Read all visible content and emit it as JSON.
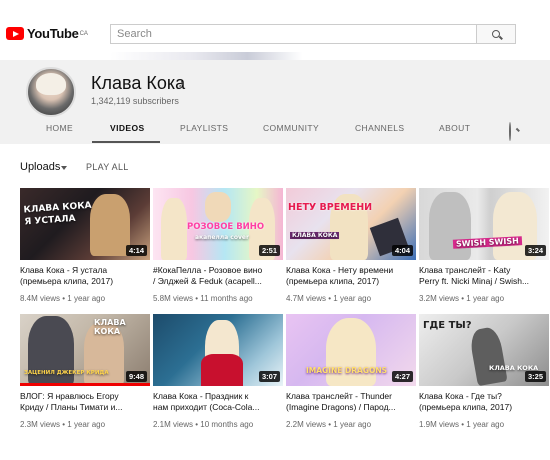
{
  "masthead": {
    "logo_text": "YouTube",
    "logo_region": "CA",
    "search_placeholder": "Search"
  },
  "channel": {
    "name": "Клава Кока",
    "subscribers": "1,342,119 subscribers"
  },
  "tabs": [
    {
      "label": "HOME"
    },
    {
      "label": "VIDEOS"
    },
    {
      "label": "PLAYLISTS"
    },
    {
      "label": "COMMUNITY"
    },
    {
      "label": "CHANNELS"
    },
    {
      "label": "ABOUT"
    }
  ],
  "uploads": {
    "label": "Uploads",
    "play_all": "PLAY ALL"
  },
  "videos": [
    {
      "title_line1": "Клава Кока - Я устала",
      "title_line2": "(премьера клипа, 2017)",
      "views": "8.4M views",
      "age": "1 year ago",
      "duration": "4:14",
      "thumb_text": "КЛАВА КОКА Я УСТАЛА"
    },
    {
      "title_line1": "#КокаПелла - Розовое вино",
      "title_line2": "/ Элджей & Feduk (acapell...",
      "views": "5.8M views",
      "age": "11 months ago",
      "duration": "2:51",
      "thumb_text": "РОЗОВОЕ ВИНО",
      "thumb_sub": "акапелла cover"
    },
    {
      "title_line1": "Клава Кока - Нету времени",
      "title_line2": "(премьера клипа, 2017)",
      "views": "4.7M views",
      "age": "1 year ago",
      "duration": "4:04",
      "thumb_text": "НЕТУ ВРЕМЕНИ",
      "thumb_sub": "КЛАВА КОКА"
    },
    {
      "title_line1": "Клава транслейт - Katy",
      "title_line2": "Perry ft. Nicki Minaj / Swish...",
      "views": "3.2M views",
      "age": "1 year ago",
      "duration": "3:24",
      "thumb_text": "SWISH SWISH"
    },
    {
      "title_line1": "ВЛОГ: Я нравлюсь Егору",
      "title_line2": "Криду / Планы Тимати и...",
      "views": "2.3M views",
      "age": "1 year ago",
      "duration": "9:48",
      "thumb_text": "КЛАВА КОКА",
      "thumb_sub": "ЗАЦЕНИЛ ДЖЕКЕР КРИДА"
    },
    {
      "title_line1": "Клава Кока - Праздник к",
      "title_line2": "нам приходит (Coca-Cola...",
      "views": "2.1M views",
      "age": "10 months ago",
      "duration": "3:07"
    },
    {
      "title_line1": "Клава транслейт - Thunder",
      "title_line2": "(Imagine Dragons) / Парод...",
      "views": "2.2M views",
      "age": "1 year ago",
      "duration": "4:27",
      "thumb_text": "IMAGINE DRAGONS"
    },
    {
      "title_line1": "Клава Кока - Где ты?",
      "title_line2": "(премьера клипа, 2017)",
      "views": "1.9M views",
      "age": "1 year ago",
      "duration": "3:25",
      "thumb_text": "ГДЕ ТЫ?",
      "thumb_sub": "КЛАВА КОКА"
    }
  ],
  "colors": {
    "brand_red": "#ff0000",
    "header_bg": "#f1f1f1",
    "progress_red": "#e00000"
  }
}
